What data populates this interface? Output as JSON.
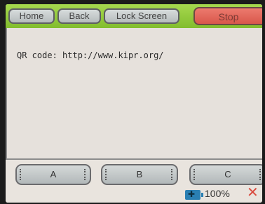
{
  "toolbar": {
    "home_label": "Home",
    "back_label": "Back",
    "lock_label": "Lock Screen",
    "stop_label": "Stop"
  },
  "main": {
    "qr_text": "QR code: http://www.kipr.org/"
  },
  "buttons": {
    "a_label": "A",
    "b_label": "B",
    "c_label": "C"
  },
  "status": {
    "battery_percent": "100%",
    "close_symbol": "✕",
    "battery_icon": "battery-charging-icon"
  },
  "colors": {
    "toolbar_green": "#95cb3f",
    "stop_red": "#e2685c",
    "battery_blue": "#2a7fb3"
  }
}
